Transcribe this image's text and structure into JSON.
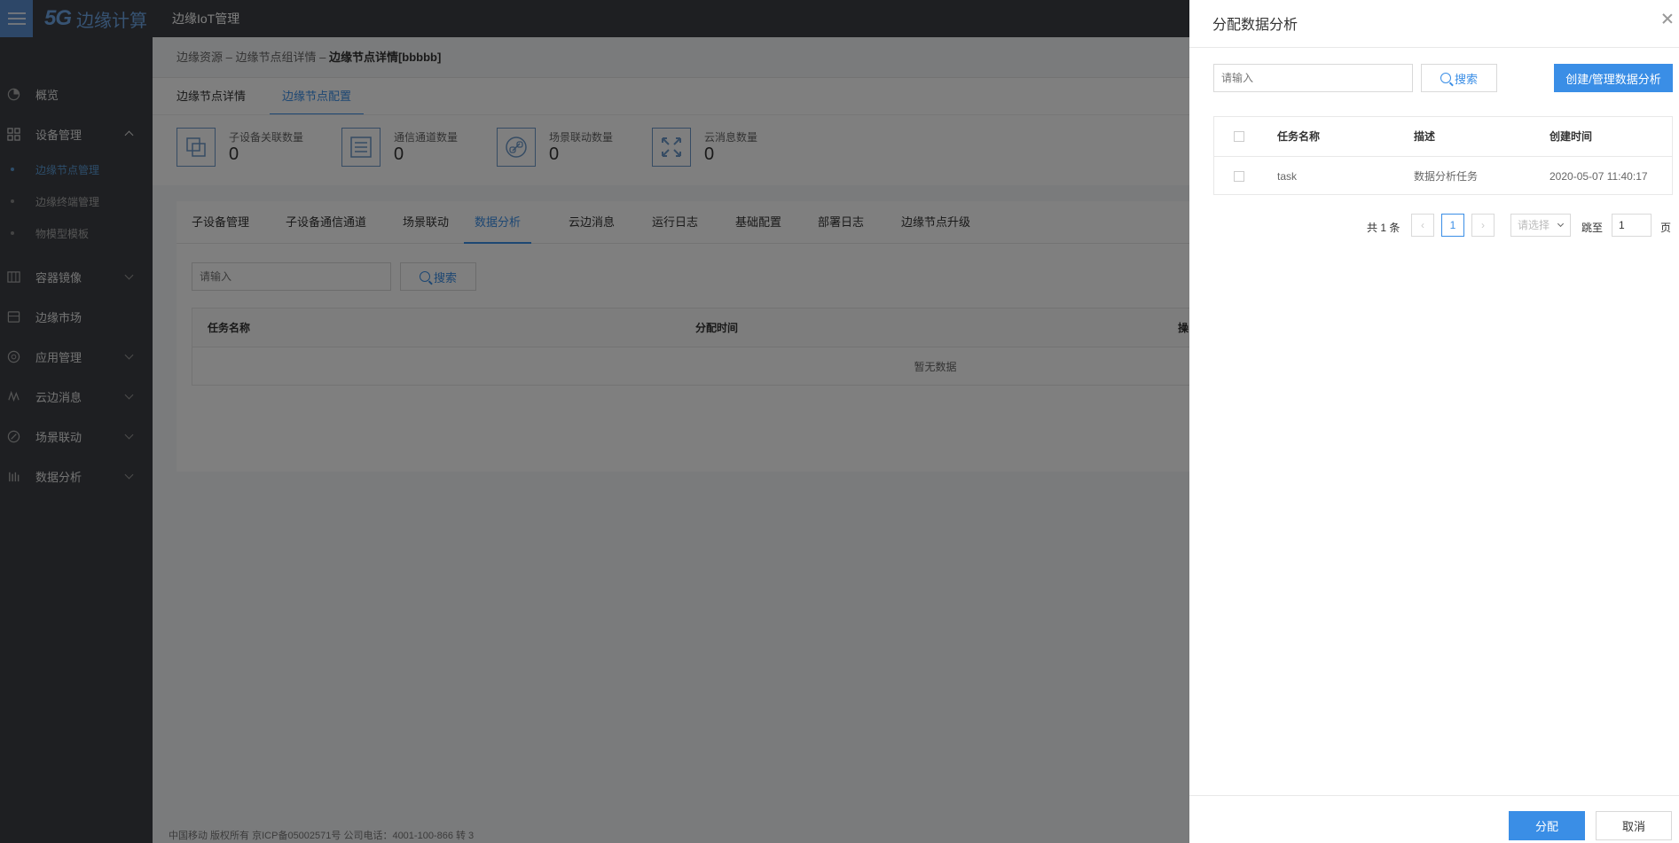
{
  "header": {
    "logo_5g": "5G",
    "logo_text": "边缘计算",
    "app_title": "边缘IoT管理"
  },
  "sidebar": {
    "items": [
      {
        "label": "概览",
        "icon": "pie-chart-icon"
      },
      {
        "label": "设备管理",
        "icon": "grid-icon",
        "expanded": true,
        "children": [
          {
            "label": "边缘节点管理",
            "active": true
          },
          {
            "label": "边缘终端管理"
          },
          {
            "label": "物模型模板"
          }
        ]
      },
      {
        "label": "容器镜像",
        "icon": "container-icon"
      },
      {
        "label": "边缘市场",
        "icon": "market-icon"
      },
      {
        "label": "应用管理",
        "icon": "app-icon"
      },
      {
        "label": "云边消息",
        "icon": "message-icon"
      },
      {
        "label": "场景联动",
        "icon": "link-icon"
      },
      {
        "label": "数据分析",
        "icon": "bar-chart-icon"
      }
    ]
  },
  "breadcrumb": {
    "part1": "边缘资源",
    "sep": " – ",
    "part2": "边缘节点组详情",
    "current": "边缘节点详情[bbbbb]"
  },
  "top_tabs": [
    "边缘节点详情",
    "边缘节点配置"
  ],
  "stats": [
    {
      "label": "子设备关联数量",
      "value": "0"
    },
    {
      "label": "通信通道数量",
      "value": "0"
    },
    {
      "label": "场景联动数量",
      "value": "0"
    },
    {
      "label": "云消息数量",
      "value": "0"
    }
  ],
  "config_tabs": [
    "子设备管理",
    "子设备通信通道",
    "场景联动",
    "数据分析",
    "云边消息",
    "运行日志",
    "基础配置",
    "部署日志",
    "边缘节点升级"
  ],
  "main_search": {
    "placeholder": "请输入",
    "button": "搜索"
  },
  "main_table": {
    "headers": [
      "任务名称",
      "分配时间",
      "操"
    ],
    "empty_text": "暂无数据"
  },
  "footer": "中国移动 版权所有 京ICP备05002571号 公司电话：4001-100-866 转 3",
  "drawer": {
    "title": "分配数据分析",
    "search_placeholder": "请输入",
    "search_button": "搜索",
    "create_button": "创建/管理数据分析",
    "table": {
      "headers": [
        "任务名称",
        "描述",
        "创建时间"
      ],
      "rows": [
        {
          "name": "task",
          "desc": "数据分析任务",
          "created": "2020-05-07 11:40:17"
        }
      ]
    },
    "pagination": {
      "total": "共 1 条",
      "current_page": "1",
      "page_size_placeholder": "请选择",
      "jump_label": "跳至",
      "jump_value": "1",
      "page_suffix": "页"
    },
    "assign_button": "分配",
    "cancel_button": "取消"
  },
  "colors": {
    "accent": "#3a8ee6",
    "sidebar_bg": "#3c3f45",
    "overlay": "rgba(0,0,0,0.5)"
  }
}
